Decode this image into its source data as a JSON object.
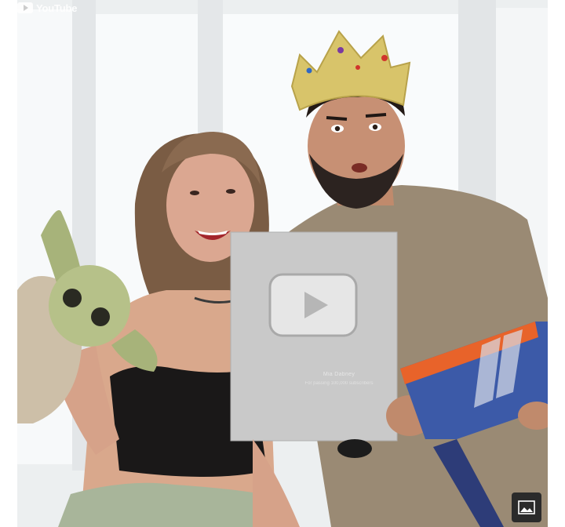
{
  "plaque": {
    "name_line": "Mia Dabney",
    "sub_line": "For passing 100,000 subscribers",
    "brand": "YouTube"
  },
  "gallery_button": {
    "icon": "image-gallery-icon",
    "color": "#2b2b2b"
  },
  "colors": {
    "wall": "#eef0f1",
    "crown": "#d8c46a",
    "blaster_blue": "#3c5aa8",
    "blaster_orange": "#e8632a",
    "plaque_silver": "#c9c9c9"
  }
}
